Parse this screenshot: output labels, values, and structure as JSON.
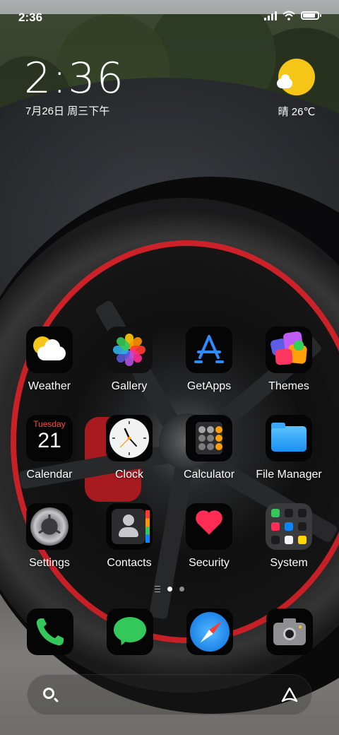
{
  "status_bar": {
    "time": "2:36",
    "signal_icon": "signal-icon",
    "wifi_icon": "wifi-icon",
    "battery_icon": "battery-icon",
    "battery_level": 0.85
  },
  "clock_widget": {
    "time": "2:36",
    "date": "7月26日 周三下午"
  },
  "weather_widget": {
    "icon": "sun-cloud-icon",
    "text": "晴 26℃"
  },
  "apps": [
    {
      "label": "Weather",
      "icon": "weather-icon"
    },
    {
      "label": "Gallery",
      "icon": "photos-flower-icon"
    },
    {
      "label": "GetApps",
      "icon": "app-store-icon"
    },
    {
      "label": "Themes",
      "icon": "themes-tiles-icon"
    },
    {
      "label": "Calendar",
      "icon": "calendar-icon",
      "weekday": "Tuesday",
      "day": "21"
    },
    {
      "label": "Clock",
      "icon": "clock-icon"
    },
    {
      "label": "Calculator",
      "icon": "calculator-icon"
    },
    {
      "label": "File Manager",
      "icon": "folder-icon"
    },
    {
      "label": "Settings",
      "icon": "gear-icon"
    },
    {
      "label": "Contacts",
      "icon": "contacts-icon"
    },
    {
      "label": "Security",
      "icon": "heart-icon"
    },
    {
      "label": "System",
      "icon": "folder-grid-icon"
    }
  ],
  "pages": {
    "count": 2,
    "current": 1
  },
  "dock": [
    {
      "name": "phone",
      "icon": "phone-icon"
    },
    {
      "name": "messages",
      "icon": "message-icon"
    },
    {
      "name": "browser",
      "icon": "compass-icon"
    },
    {
      "name": "camera",
      "icon": "camera-icon"
    }
  ],
  "search_bar": {
    "search_icon": "search-icon",
    "assistant_icon": "assistant-icon"
  },
  "colors": {
    "accent_green": "#34c759",
    "accent_blue": "#0a84ff",
    "sun_yellow": "#f5c518",
    "heart_red": "#ff2d55",
    "calendar_red": "#ff4a40"
  }
}
